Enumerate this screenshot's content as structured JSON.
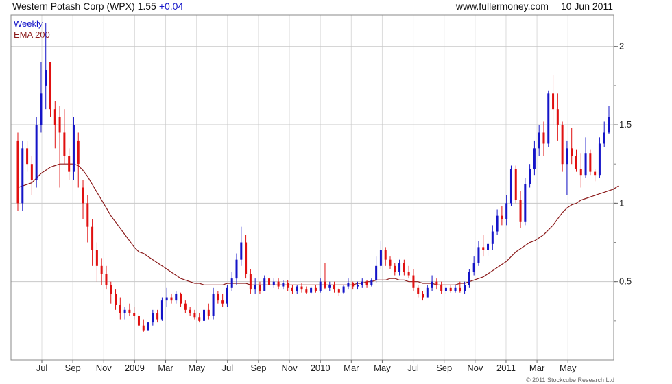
{
  "header": {
    "title": "Western Potash Corp (WPX)",
    "price": "1.55",
    "change": "+0.04",
    "site": "www.fullermoney.com",
    "date": "10 Jun 2011"
  },
  "legend": {
    "period": "Weekly",
    "indicator": "EMA 200"
  },
  "footer": {
    "copyright": "© 2011 Stockcube Research Ltd"
  },
  "colors": {
    "up": "#1414c8",
    "down": "#e01010",
    "ema": "#8b1a1a",
    "grid": "#c8c8c8"
  },
  "chart_data": {
    "type": "candlestick",
    "title": "Western Potash Corp (WPX)",
    "period": "Weekly",
    "ylim": [
      0,
      2.2
    ],
    "y_ticks": [
      "0.5",
      "1",
      "1.5",
      "2"
    ],
    "x_ticks": [
      "Jul",
      "Sep",
      "Nov",
      "2009",
      "Mar",
      "May",
      "Jul",
      "Sep",
      "Nov",
      "2010",
      "Mar",
      "May",
      "Jul",
      "Sep",
      "Nov",
      "2011",
      "Mar",
      "May"
    ],
    "candles": [
      [
        1.4,
        1.45,
        0.95,
        1.0
      ],
      [
        1.0,
        1.4,
        0.95,
        1.35
      ],
      [
        1.35,
        1.4,
        1.2,
        1.25
      ],
      [
        1.25,
        1.3,
        1.05,
        1.15
      ],
      [
        1.15,
        1.55,
        1.1,
        1.5
      ],
      [
        1.5,
        1.9,
        1.45,
        1.7
      ],
      [
        1.75,
        2.15,
        1.6,
        1.85
      ],
      [
        1.9,
        1.9,
        1.55,
        1.6
      ],
      [
        1.6,
        1.65,
        1.35,
        1.5
      ],
      [
        1.55,
        1.62,
        1.1,
        1.45
      ],
      [
        1.45,
        1.6,
        1.25,
        1.3
      ],
      [
        1.3,
        1.35,
        1.15,
        1.2
      ],
      [
        1.2,
        1.55,
        1.15,
        1.5
      ],
      [
        1.4,
        1.45,
        1.1,
        1.25
      ],
      [
        1.1,
        1.15,
        0.9,
        1.0
      ],
      [
        1.0,
        1.05,
        0.75,
        0.85
      ],
      [
        0.85,
        0.9,
        0.6,
        0.7
      ],
      [
        0.7,
        0.75,
        0.5,
        0.6
      ],
      [
        0.6,
        0.65,
        0.48,
        0.55
      ],
      [
        0.55,
        0.6,
        0.45,
        0.48
      ],
      [
        0.48,
        0.5,
        0.36,
        0.42
      ],
      [
        0.42,
        0.45,
        0.32,
        0.35
      ],
      [
        0.35,
        0.4,
        0.26,
        0.3
      ],
      [
        0.3,
        0.34,
        0.26,
        0.32
      ],
      [
        0.32,
        0.36,
        0.28,
        0.3
      ],
      [
        0.3,
        0.34,
        0.26,
        0.28
      ],
      [
        0.28,
        0.3,
        0.2,
        0.22
      ],
      [
        0.22,
        0.26,
        0.18,
        0.19
      ],
      [
        0.19,
        0.24,
        0.19,
        0.24
      ],
      [
        0.24,
        0.32,
        0.22,
        0.3
      ],
      [
        0.3,
        0.32,
        0.24,
        0.26
      ],
      [
        0.26,
        0.4,
        0.25,
        0.38
      ],
      [
        0.38,
        0.46,
        0.34,
        0.4
      ],
      [
        0.4,
        0.42,
        0.36,
        0.38
      ],
      [
        0.38,
        0.44,
        0.36,
        0.42
      ],
      [
        0.42,
        0.43,
        0.34,
        0.36
      ],
      [
        0.36,
        0.38,
        0.3,
        0.32
      ],
      [
        0.32,
        0.34,
        0.28,
        0.3
      ],
      [
        0.3,
        0.32,
        0.26,
        0.27
      ],
      [
        0.27,
        0.3,
        0.24,
        0.25
      ],
      [
        0.25,
        0.34,
        0.25,
        0.32
      ],
      [
        0.32,
        0.36,
        0.26,
        0.28
      ],
      [
        0.28,
        0.46,
        0.26,
        0.42
      ],
      [
        0.42,
        0.44,
        0.36,
        0.38
      ],
      [
        0.38,
        0.42,
        0.34,
        0.36
      ],
      [
        0.36,
        0.48,
        0.34,
        0.46
      ],
      [
        0.46,
        0.56,
        0.44,
        0.52
      ],
      [
        0.52,
        0.68,
        0.48,
        0.64
      ],
      [
        0.64,
        0.85,
        0.6,
        0.75
      ],
      [
        0.75,
        0.8,
        0.52,
        0.55
      ],
      [
        0.55,
        0.58,
        0.42,
        0.45
      ],
      [
        0.45,
        0.52,
        0.42,
        0.48
      ],
      [
        0.48,
        0.5,
        0.42,
        0.44
      ],
      [
        0.44,
        0.54,
        0.44,
        0.52
      ],
      [
        0.52,
        0.53,
        0.46,
        0.48
      ],
      [
        0.48,
        0.52,
        0.46,
        0.5
      ],
      [
        0.5,
        0.52,
        0.45,
        0.47
      ],
      [
        0.47,
        0.51,
        0.45,
        0.49
      ],
      [
        0.49,
        0.51,
        0.44,
        0.46
      ],
      [
        0.46,
        0.48,
        0.42,
        0.44
      ],
      [
        0.44,
        0.48,
        0.42,
        0.47
      ],
      [
        0.47,
        0.49,
        0.43,
        0.45
      ],
      [
        0.45,
        0.47,
        0.42,
        0.43
      ],
      [
        0.43,
        0.47,
        0.42,
        0.46
      ],
      [
        0.46,
        0.48,
        0.43,
        0.44
      ],
      [
        0.44,
        0.52,
        0.43,
        0.5
      ],
      [
        0.5,
        0.62,
        0.45,
        0.46
      ],
      [
        0.46,
        0.5,
        0.44,
        0.48
      ],
      [
        0.48,
        0.5,
        0.43,
        0.45
      ],
      [
        0.45,
        0.46,
        0.41,
        0.43
      ],
      [
        0.43,
        0.48,
        0.42,
        0.47
      ],
      [
        0.47,
        0.52,
        0.45,
        0.49
      ],
      [
        0.49,
        0.5,
        0.45,
        0.47
      ],
      [
        0.47,
        0.5,
        0.45,
        0.48
      ],
      [
        0.48,
        0.52,
        0.46,
        0.5
      ],
      [
        0.5,
        0.51,
        0.46,
        0.48
      ],
      [
        0.48,
        0.52,
        0.47,
        0.51
      ],
      [
        0.51,
        0.66,
        0.49,
        0.6
      ],
      [
        0.6,
        0.76,
        0.58,
        0.7
      ],
      [
        0.7,
        0.72,
        0.6,
        0.64
      ],
      [
        0.64,
        0.66,
        0.58,
        0.6
      ],
      [
        0.6,
        0.62,
        0.54,
        0.56
      ],
      [
        0.56,
        0.64,
        0.54,
        0.62
      ],
      [
        0.62,
        0.64,
        0.54,
        0.56
      ],
      [
        0.56,
        0.6,
        0.52,
        0.54
      ],
      [
        0.54,
        0.58,
        0.44,
        0.46
      ],
      [
        0.46,
        0.48,
        0.4,
        0.42
      ],
      [
        0.42,
        0.44,
        0.38,
        0.4
      ],
      [
        0.4,
        0.48,
        0.4,
        0.46
      ],
      [
        0.46,
        0.54,
        0.44,
        0.5
      ],
      [
        0.5,
        0.52,
        0.45,
        0.48
      ],
      [
        0.48,
        0.5,
        0.42,
        0.44
      ],
      [
        0.44,
        0.48,
        0.42,
        0.46
      ],
      [
        0.46,
        0.48,
        0.43,
        0.44
      ],
      [
        0.44,
        0.48,
        0.43,
        0.46
      ],
      [
        0.46,
        0.5,
        0.43,
        0.44
      ],
      [
        0.44,
        0.5,
        0.42,
        0.48
      ],
      [
        0.48,
        0.58,
        0.46,
        0.56
      ],
      [
        0.56,
        0.66,
        0.54,
        0.62
      ],
      [
        0.62,
        0.76,
        0.6,
        0.72
      ],
      [
        0.72,
        0.8,
        0.66,
        0.7
      ],
      [
        0.7,
        0.76,
        0.66,
        0.74
      ],
      [
        0.74,
        0.86,
        0.7,
        0.82
      ],
      [
        0.82,
        0.96,
        0.8,
        0.92
      ],
      [
        0.92,
        0.98,
        0.86,
        0.9
      ],
      [
        0.9,
        1.05,
        0.86,
        1.0
      ],
      [
        1.0,
        1.24,
        0.98,
        1.22
      ],
      [
        1.22,
        1.24,
        1.0,
        1.02
      ],
      [
        1.02,
        1.08,
        0.84,
        0.88
      ],
      [
        0.88,
        1.16,
        0.86,
        1.12
      ],
      [
        1.12,
        1.25,
        1.1,
        1.22
      ],
      [
        1.22,
        1.4,
        1.18,
        1.35
      ],
      [
        1.35,
        1.5,
        1.3,
        1.45
      ],
      [
        1.45,
        1.52,
        1.3,
        1.38
      ],
      [
        1.38,
        1.72,
        1.36,
        1.7
      ],
      [
        1.7,
        1.82,
        1.5,
        1.6
      ],
      [
        1.6,
        1.7,
        1.4,
        1.5
      ],
      [
        1.5,
        1.52,
        1.2,
        1.25
      ],
      [
        1.25,
        1.4,
        1.05,
        1.35
      ],
      [
        1.35,
        1.48,
        1.25,
        1.3
      ],
      [
        1.3,
        1.34,
        1.2,
        1.22
      ],
      [
        1.22,
        1.32,
        1.1,
        1.18
      ],
      [
        1.18,
        1.42,
        1.16,
        1.32
      ],
      [
        1.32,
        1.34,
        1.18,
        1.2
      ],
      [
        1.2,
        1.22,
        1.14,
        1.18
      ],
      [
        1.18,
        1.42,
        1.16,
        1.38
      ],
      [
        1.38,
        1.52,
        1.36,
        1.45
      ],
      [
        1.45,
        1.62,
        1.44,
        1.55
      ]
    ],
    "ema_200": [
      1.1,
      1.11,
      1.12,
      1.13,
      1.16,
      1.19,
      1.21,
      1.23,
      1.24,
      1.25,
      1.25,
      1.25,
      1.25,
      1.24,
      1.21,
      1.17,
      1.12,
      1.07,
      1.02,
      0.97,
      0.92,
      0.88,
      0.84,
      0.8,
      0.76,
      0.72,
      0.69,
      0.68,
      0.66,
      0.64,
      0.62,
      0.6,
      0.58,
      0.56,
      0.54,
      0.52,
      0.51,
      0.5,
      0.49,
      0.49,
      0.48,
      0.48,
      0.48,
      0.48,
      0.48,
      0.49,
      0.49,
      0.49,
      0.49,
      0.49,
      0.48,
      0.48,
      0.48,
      0.48,
      0.48,
      0.48,
      0.48,
      0.48,
      0.48,
      0.48,
      0.48,
      0.48,
      0.48,
      0.48,
      0.48,
      0.48,
      0.48,
      0.48,
      0.48,
      0.48,
      0.48,
      0.48,
      0.48,
      0.49,
      0.49,
      0.5,
      0.5,
      0.51,
      0.51,
      0.51,
      0.52,
      0.52,
      0.51,
      0.51,
      0.5,
      0.5,
      0.5,
      0.49,
      0.49,
      0.49,
      0.48,
      0.48,
      0.48,
      0.48,
      0.48,
      0.49,
      0.49,
      0.5,
      0.51,
      0.52,
      0.53,
      0.55,
      0.57,
      0.59,
      0.61,
      0.63,
      0.66,
      0.69,
      0.71,
      0.73,
      0.75,
      0.76,
      0.78,
      0.8,
      0.83,
      0.86,
      0.9,
      0.94,
      0.97,
      0.99,
      1.0,
      1.02,
      1.03,
      1.04,
      1.05,
      1.06,
      1.07,
      1.08,
      1.09,
      1.11
    ]
  }
}
